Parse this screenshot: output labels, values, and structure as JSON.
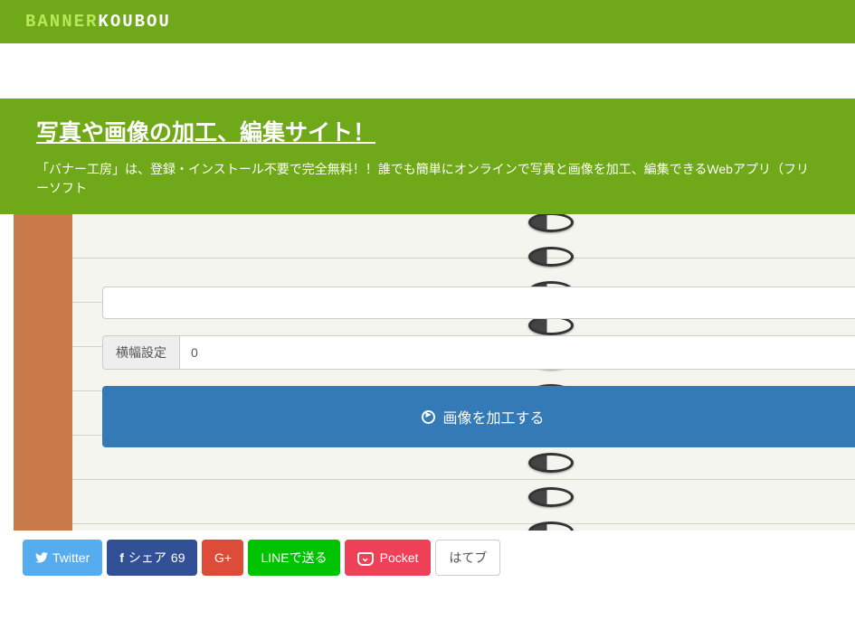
{
  "logo": {
    "part1": "BANNER",
    "part2": "KOUBOU"
  },
  "title": {
    "main": "写真や画像の加工、編集サイト！",
    "sub": "「バナー工房」は、登録・インストール不要で完全無料！！誰でも簡単にオンラインで写真と画像を加工、編集できるWebアプリ（フリーソフト"
  },
  "form": {
    "width_label": "横幅設定",
    "width_value": "0"
  },
  "process_button": "画像を加工する",
  "share": {
    "twitter": "Twitter",
    "facebook_label": "シェア",
    "facebook_count": "69",
    "gplus": "G+",
    "line": "LINEで送る",
    "pocket": "Pocket",
    "hatena": "はてブ"
  }
}
